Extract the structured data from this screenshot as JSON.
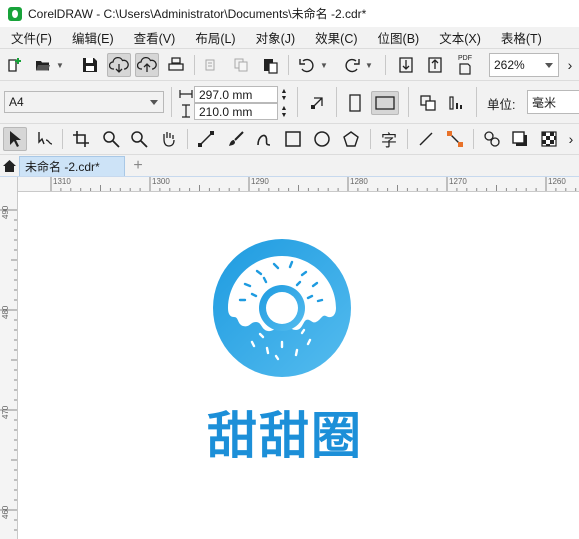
{
  "window": {
    "title": "CorelDRAW - C:\\Users\\Administrator\\Documents\\未命名 -2.cdr*"
  },
  "menu": {
    "items": [
      "文件(F)",
      "编辑(E)",
      "查看(V)",
      "布局(L)",
      "对象(J)",
      "效果(C)",
      "位图(B)",
      "文本(X)",
      "表格(T)"
    ]
  },
  "toolbar": {
    "zoom_value": "262%",
    "pdf_label": "PDF"
  },
  "property_bar": {
    "page_size": "A4",
    "width": "297.0 mm",
    "height": "210.0 mm",
    "units_label": "单位:",
    "units_value": "毫米"
  },
  "tabs": {
    "document": "未命名 -2.cdr*",
    "add": "+"
  },
  "ruler": {
    "horizontal": [
      "1310",
      "1300",
      "1290",
      "1280",
      "1270",
      "1260"
    ],
    "vertical": [
      "490",
      "480",
      "470",
      "460"
    ]
  },
  "artwork": {
    "brand_text": "甜甜圈",
    "brand_color": "#1c8fd8",
    "donut_color_light": "#5bbcef",
    "donut_color_dark": "#0d86d6"
  },
  "toolbox": {
    "text_tool_glyph": "字"
  }
}
